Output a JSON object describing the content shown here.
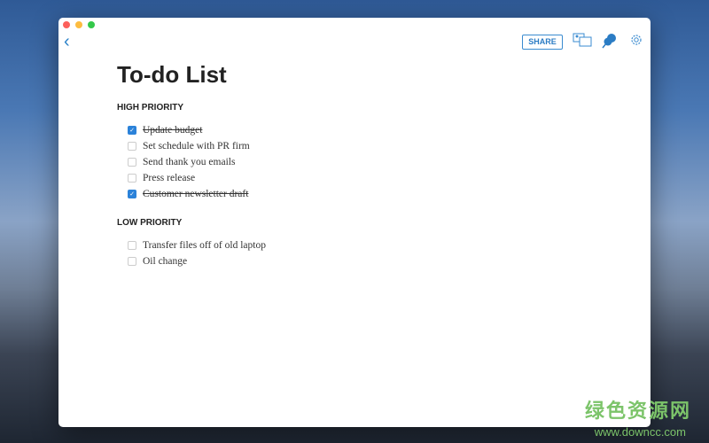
{
  "toolbar": {
    "share_label": "SHARE"
  },
  "title": "To-do List",
  "sections": [
    {
      "heading": "HIGH PRIORITY",
      "items": [
        {
          "text": "Update budget",
          "checked": true
        },
        {
          "text": "Set schedule with PR firm",
          "checked": false
        },
        {
          "text": "Send thank you emails",
          "checked": false
        },
        {
          "text": "Press release",
          "checked": false
        },
        {
          "text": "Customer newsletter draft",
          "checked": true
        }
      ]
    },
    {
      "heading": "LOW PRIORITY",
      "items": [
        {
          "text": "Transfer files off of old laptop",
          "checked": false
        },
        {
          "text": "Oil change",
          "checked": false
        }
      ]
    }
  ],
  "watermark": {
    "line1": "绿色资源网",
    "line2": "www.downcc.com"
  },
  "colors": {
    "accent": "#2b82d9"
  }
}
